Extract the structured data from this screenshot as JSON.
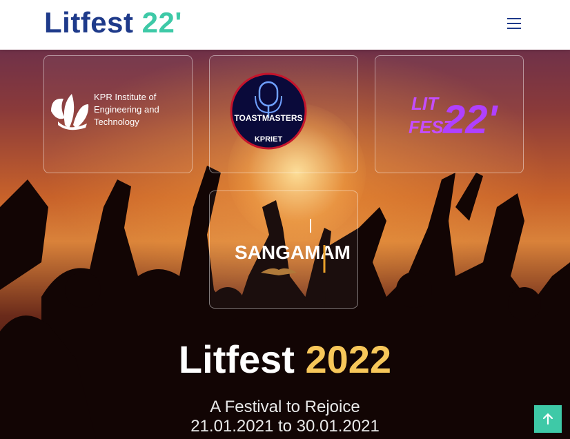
{
  "navbar": {
    "brand_text": "Litfest",
    "brand_accent": "22'",
    "menu_icon": "hamburger-icon"
  },
  "logos": {
    "kpr": {
      "name": "KPR Institute of Engineering and Technology",
      "lines": [
        "KPR Institute of",
        "Engineering and",
        "Technology"
      ]
    },
    "toastmasters": {
      "top": "TOASTMASTERS",
      "bottom": "KPRIET"
    },
    "litfest": {
      "line1": "LIT",
      "line2": "FEST",
      "num": "22'"
    },
    "sangamam": {
      "text": "SANGAMAM"
    }
  },
  "hero": {
    "title": "Litfest",
    "title_year": "2022",
    "tagline": "A Festival to Rejoice",
    "dates": "21.01.2021 to 30.01.2021"
  },
  "back_to_top": {
    "icon": "arrow-up-icon"
  },
  "colors": {
    "brand_blue": "#1e3a8a",
    "brand_teal": "#3ec9a7",
    "year_gold": "#f7c75a"
  }
}
